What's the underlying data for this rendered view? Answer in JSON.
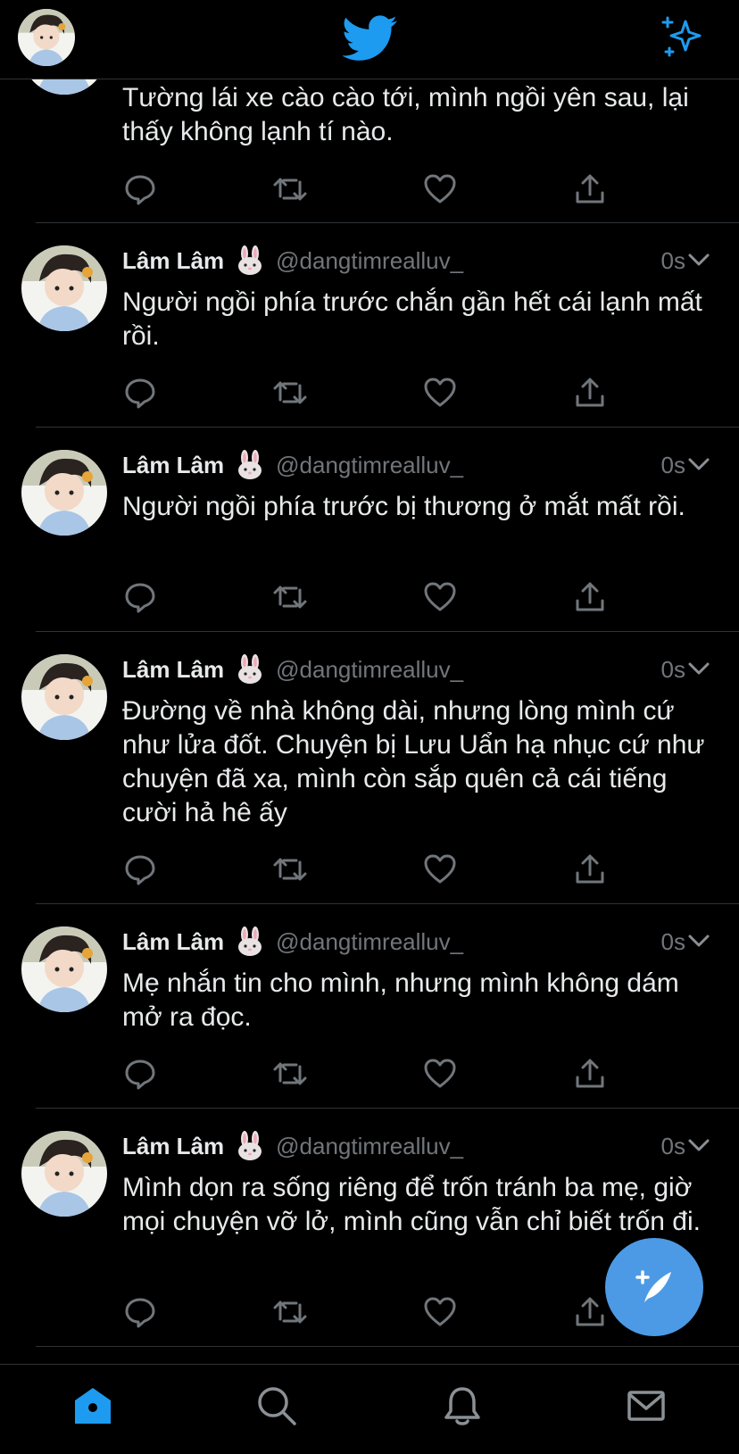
{
  "header": {
    "logo_icon": "twitter-bird-icon",
    "sparkle_icon": "sparkle-icon",
    "brand_color": "#1d9bf0"
  },
  "partial_tweet": {
    "text": "Tường lái xe cào cào tới, mình ngồi yên sau, lại thấy không lạnh tí nào."
  },
  "tweets": [
    {
      "name": "Lâm Lâm",
      "emoji": "🐰",
      "handle": "@dangtimrealluv_",
      "time": "0s",
      "text": "Người ngồi phía trước chắn gần hết cái lạnh mất rồi."
    },
    {
      "name": "Lâm Lâm",
      "emoji": "🐰",
      "handle": "@dangtimrealluv_",
      "time": "0s",
      "text": "Người ngồi phía trước bị thương ở mắt mất rồi."
    },
    {
      "name": "Lâm Lâm",
      "emoji": "🐰",
      "handle": "@dangtimrealluv_",
      "time": "0s",
      "text": "Đường về nhà không dài, nhưng lòng mình cứ như lửa đốt. Chuyện bị Lưu Uẩn hạ nhục cứ như chuyện đã xa, mình còn sắp quên cả cái tiếng cười hả hê ấy"
    },
    {
      "name": "Lâm Lâm",
      "emoji": "🐰",
      "handle": "@dangtimrealluv_",
      "time": "0s",
      "text": "Mẹ nhắn tin cho mình, nhưng mình không dám mở ra đọc."
    },
    {
      "name": "Lâm Lâm",
      "emoji": "🐰",
      "handle": "@dangtimrealluv_",
      "time": "0s",
      "text": "Mình dọn ra sống riêng để trốn tránh ba mẹ, giờ mọi chuyện vỡ lở, mình cũng vẫn chỉ biết trốn đi."
    }
  ],
  "bottom_nav": {
    "items": [
      "home-icon",
      "search-icon",
      "notifications-icon",
      "messages-icon"
    ],
    "active": "home-icon"
  },
  "fab": {
    "icon": "compose-tweet-icon",
    "color": "#4c9ae6"
  }
}
